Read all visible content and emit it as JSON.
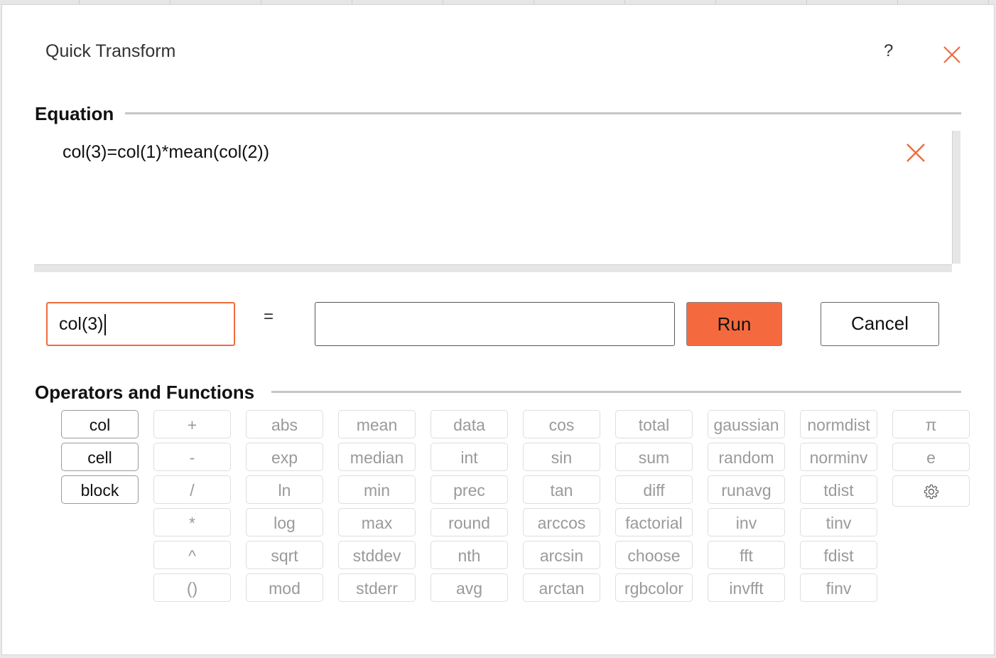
{
  "dialog": {
    "title": "Quick Transform",
    "help_label": "?"
  },
  "equation": {
    "section_title": "Equation",
    "text": "col(3)=col(1)*mean(col(2))"
  },
  "editor": {
    "target_value": "col(3)",
    "equals": "=",
    "expression_value": "",
    "run_label": "Run",
    "cancel_label": "Cancel"
  },
  "functions": {
    "section_title": "Operators and Functions",
    "columns": [
      [
        "col",
        "cell",
        "block"
      ],
      [
        "+",
        "-",
        "/",
        "*",
        "^",
        "()"
      ],
      [
        "abs",
        "exp",
        "ln",
        "log",
        "sqrt",
        "mod"
      ],
      [
        "mean",
        "median",
        "min",
        "max",
        "stddev",
        "stderr"
      ],
      [
        "data",
        "int",
        "prec",
        "round",
        "nth",
        "avg"
      ],
      [
        "cos",
        "sin",
        "tan",
        "arccos",
        "arcsin",
        "arctan"
      ],
      [
        "total",
        "sum",
        "diff",
        "factorial",
        "choose",
        "rgbcolor"
      ],
      [
        "gaussian",
        "random",
        "runavg",
        "inv",
        "fft",
        "invfft"
      ],
      [
        "normdist",
        "norminv",
        "tdist",
        "tinv",
        "fdist",
        "finv"
      ],
      [
        "π",
        "e",
        "gear-icon"
      ]
    ],
    "active_column": 0
  },
  "colors": {
    "accent": "#f46a3e",
    "accent_border": "#f26b3a"
  }
}
